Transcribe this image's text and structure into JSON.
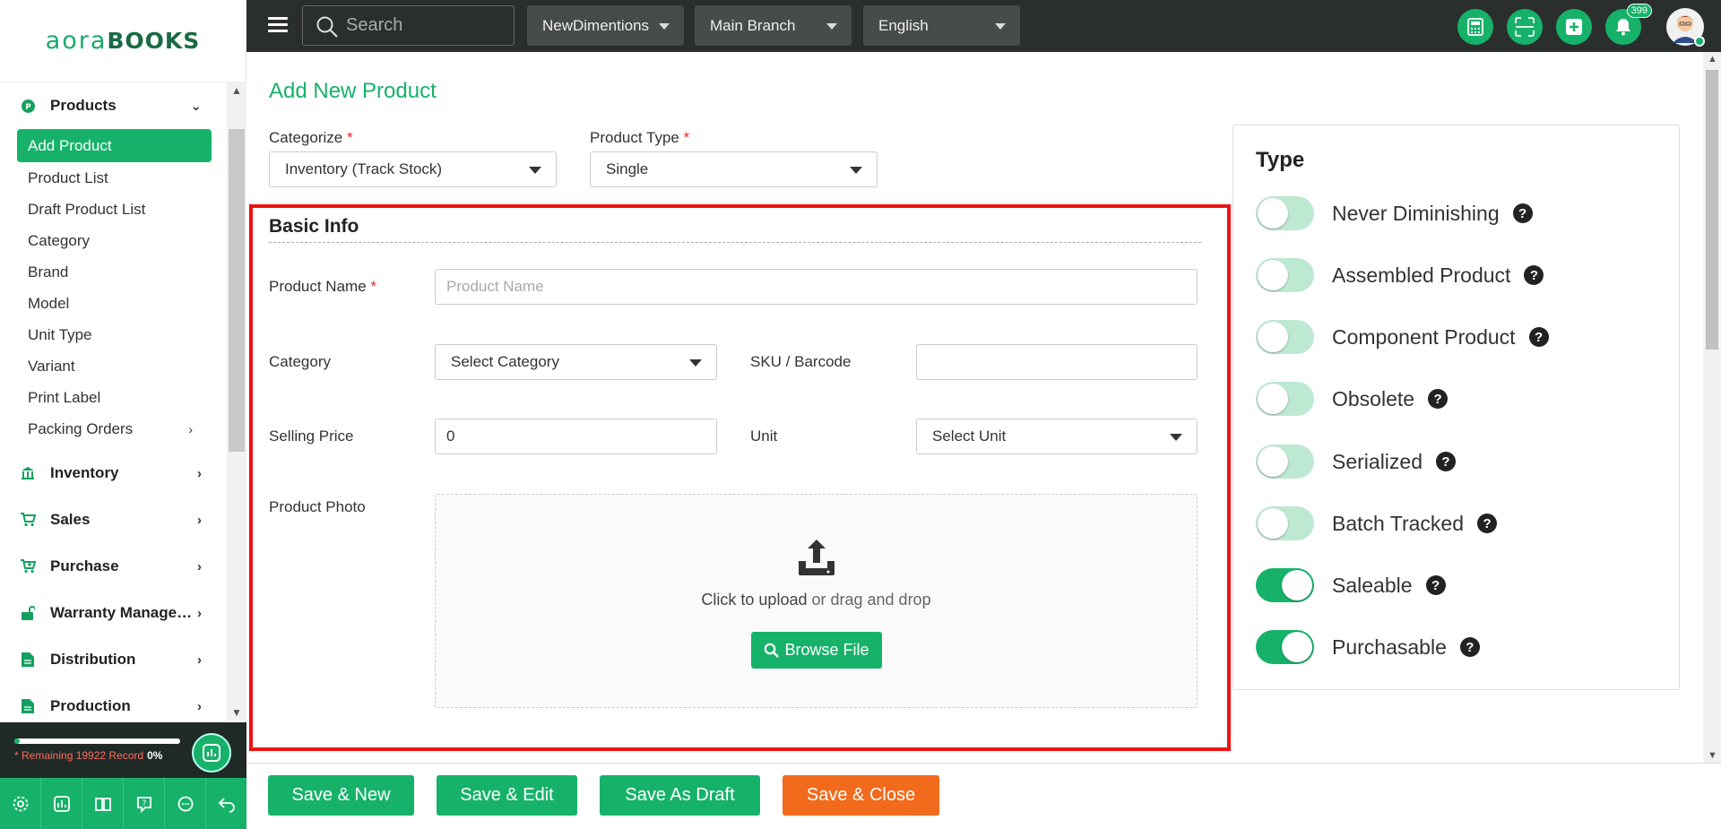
{
  "brand": {
    "logo_part1": "aora",
    "logo_part2": "BOOKS"
  },
  "sidebar": {
    "products_group": "Products",
    "product_items": [
      {
        "label": "Add Product",
        "active": true
      },
      {
        "label": "Product List"
      },
      {
        "label": "Draft Product List"
      },
      {
        "label": "Category"
      },
      {
        "label": "Brand"
      },
      {
        "label": "Model"
      },
      {
        "label": "Unit Type"
      },
      {
        "label": "Variant"
      },
      {
        "label": "Print Label"
      },
      {
        "label": "Packing Orders",
        "has_submenu": true
      }
    ],
    "groups": [
      {
        "label": "Inventory",
        "icon": "bank-icon"
      },
      {
        "label": "Sales",
        "icon": "cart-icon"
      },
      {
        "label": "Purchase",
        "icon": "cart-plus-icon"
      },
      {
        "label": "Warranty Manage…",
        "icon": "unlock-icon"
      },
      {
        "label": "Distribution",
        "icon": "file-icon"
      },
      {
        "label": "Production",
        "icon": "file-icon"
      }
    ],
    "footer": {
      "remaining_text": "* Remaining 19922 Record",
      "percent": "0%",
      "progress_fraction": 0.0,
      "icons": [
        "settings-icon",
        "chart-icon",
        "book-icon",
        "help-icon",
        "chat-icon",
        "back-arrow-icon"
      ]
    }
  },
  "topbar": {
    "search_placeholder": "Search",
    "company": "NewDimentions",
    "branch": "Main Branch",
    "language": "English",
    "notification_count": "399",
    "icons": [
      "calculator-icon",
      "scan-icon",
      "plus-square-icon",
      "bell-icon"
    ]
  },
  "main": {
    "title": "Add New Product",
    "categorize_label": "Categorize",
    "categorize_value": "Inventory (Track Stock)",
    "product_type_label": "Product Type",
    "product_type_value": "Single",
    "basic_info": {
      "title": "Basic Info",
      "product_name_label": "Product Name",
      "product_name_placeholder": "Product Name",
      "category_label": "Category",
      "category_value": "Select Category",
      "sku_label": "SKU / Barcode",
      "sku_value": "",
      "selling_price_label": "Selling Price",
      "selling_price_value": "0",
      "unit_label": "Unit",
      "unit_value": "Select Unit",
      "photo_label": "Product Photo",
      "upload_strong": "Click to upload",
      "upload_rest": " or drag and drop",
      "browse_label": "Browse File"
    },
    "type_panel": {
      "title": "Type",
      "options": [
        {
          "label": "Never Diminishing",
          "on": false
        },
        {
          "label": "Assembled Product",
          "on": false
        },
        {
          "label": "Component Product",
          "on": false
        },
        {
          "label": "Obsolete",
          "on": false
        },
        {
          "label": "Serialized",
          "on": false
        },
        {
          "label": "Batch Tracked",
          "on": false
        },
        {
          "label": "Saleable",
          "on": true
        },
        {
          "label": "Purchasable",
          "on": true
        }
      ]
    }
  },
  "actions": {
    "save_new": "Save & New",
    "save_edit": "Save & Edit",
    "save_draft": "Save As Draft",
    "save_close": "Save & Close"
  },
  "colors": {
    "accent": "#17b26a",
    "orange": "#f26a1b",
    "highlight": "#ee1111",
    "topbar": "#2a2f2e"
  }
}
